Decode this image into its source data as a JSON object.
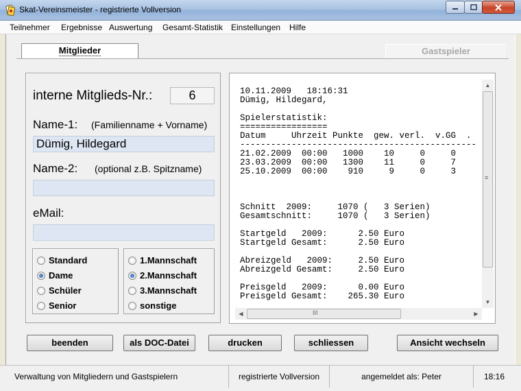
{
  "window": {
    "title": "Skat-Vereinsmeister - registrierte Vollversion",
    "app_icon": "skat-cards-icon"
  },
  "menu": [
    "Teilnehmer",
    "Ergebnisse",
    "Auswertung",
    "Gesamt-Statistik",
    "Einstellungen",
    "Hilfe"
  ],
  "tabs": {
    "members": "Mitglieder",
    "guests": "Gastspieler",
    "active": "members"
  },
  "form": {
    "member_no_label": "interne Mitglieds-Nr.:",
    "member_no": "6",
    "name1_label": "Name-1:",
    "name1_hint": "(Familienname + Vorname)",
    "name1_value": "Dümig, Hildegard",
    "name2_label": "Name-2:",
    "name2_hint": "(optional z.B. Spitzname)",
    "name2_value": "",
    "email_label": "eMail:",
    "email_value": ""
  },
  "category_options": [
    {
      "label": "Standard",
      "checked": false
    },
    {
      "label": "Dame",
      "checked": true
    },
    {
      "label": "Schüler",
      "checked": false
    },
    {
      "label": "Senior",
      "checked": false
    }
  ],
  "team_options": [
    {
      "label": "1.Mannschaft",
      "checked": false
    },
    {
      "label": "2.Mannschaft",
      "checked": true
    },
    {
      "label": "3.Mannschaft",
      "checked": false
    },
    {
      "label": "sonstige",
      "checked": false
    }
  ],
  "statistics_text": [
    "10.11.2009   18:16:31",
    "Dümig, Hildegard,",
    "",
    "Spielerstatistik:",
    "=================",
    "Datum     Uhrzeit Punkte  gew. verl.  v.GG  .",
    "----------------------------------------------",
    "21.02.2009  00:00   1000    10     0     0",
    "23.03.2009  00:00   1300    11     0     7",
    "25.10.2009  00:00    910     9     0     3",
    "",
    "",
    "",
    "Schnitt  2009:     1070 (   3 Serien)",
    "Gesamtschnitt:     1070 (   3 Serien)",
    "",
    "Startgeld   2009:      2.50 Euro",
    "Startgeld Gesamt:      2.50 Euro",
    "",
    "Abreizgeld   2009:     2.50 Euro",
    "Abreizgeld Gesamt:     2.50 Euro",
    "",
    "Preisgeld   2009:      0.00 Euro",
    "Preisgeld Gesamt:    265.30 Euro"
  ],
  "buttons": {
    "quit": "beenden",
    "doc": "als DOC-Datei",
    "print": "drucken",
    "close": "schliessen",
    "switch_view": "Ansicht wechseln"
  },
  "status": {
    "description": "Verwaltung von Mitgliedern und Gastspielern",
    "license": "registrierte Vollversion",
    "user": "angemeldet als: Peter",
    "time": "18:16"
  }
}
